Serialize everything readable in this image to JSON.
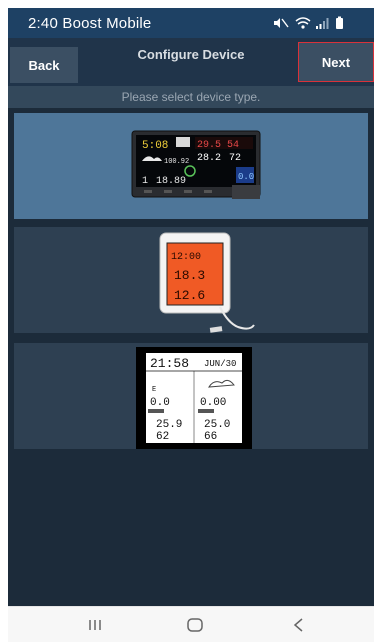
{
  "status_bar": {
    "time_carrier": "2:40 Boost Mobile"
  },
  "nav": {
    "back_label": "Back",
    "title": "Configure Device",
    "next_label": "Next"
  },
  "subtitle": "Please select device type.",
  "devices": [
    {
      "selected": true,
      "lcd_time": "5:08",
      "lcd_values": [
        "29.5",
        "54",
        "100.92",
        "28.2",
        "72",
        "1",
        "18.89",
        "0.0"
      ]
    },
    {
      "selected": false,
      "lcd_values": [
        "12:00",
        "18.3",
        "12.6"
      ]
    },
    {
      "selected": false,
      "lcd_time": "21:58",
      "lcd_date": "JUN/30",
      "lcd_values": [
        "0.0",
        "0.00",
        "25.9",
        "62",
        "25.0",
        "66"
      ]
    }
  ],
  "colors": {
    "status_bar": "#1e4164",
    "nav_bar": "#20344a",
    "background": "#1c2b3a",
    "selected_card": "#4e7699",
    "next_border": "#d9323a"
  }
}
